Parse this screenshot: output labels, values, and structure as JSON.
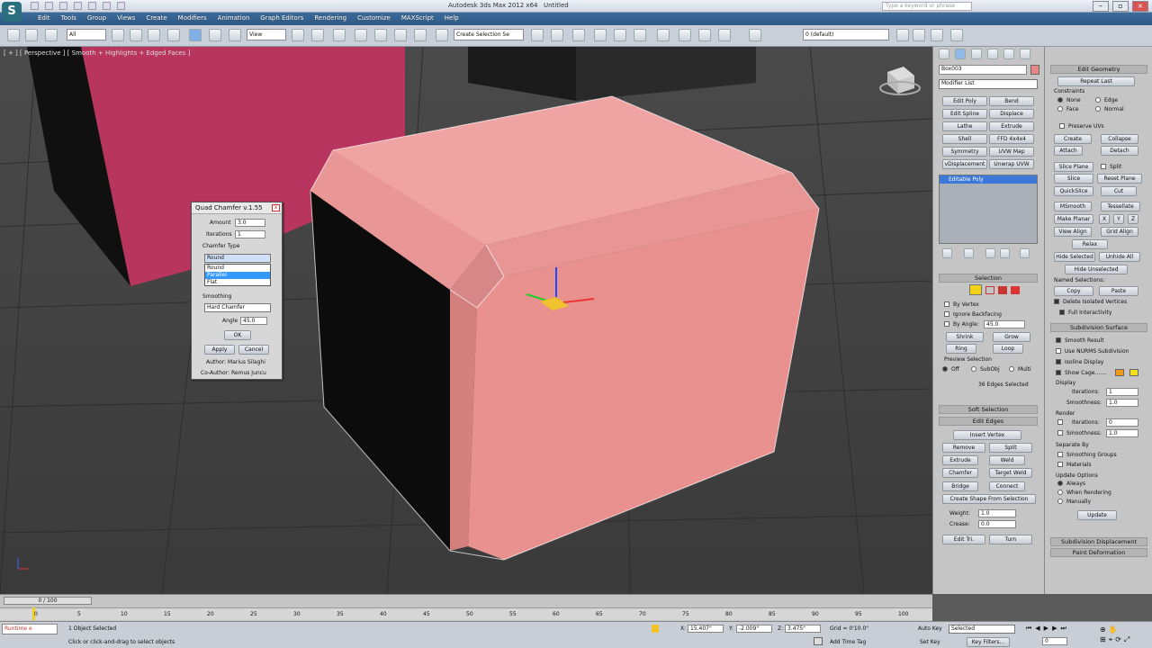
{
  "app": {
    "title": "Autodesk 3ds Max 2012 x64",
    "document": "Untitled",
    "search_placeholder": "Type a keyword or phrase"
  },
  "menu": [
    "Edit",
    "Tools",
    "Group",
    "Views",
    "Create",
    "Modifiers",
    "Animation",
    "Graph Editors",
    "Rendering",
    "Customize",
    "MAXScript",
    "Help"
  ],
  "toolbar": {
    "filter": "All",
    "ref_coord": "View",
    "selection_set": "Create Selection Se",
    "layer": "0 (default)"
  },
  "viewport": {
    "label": "[ + ] [ Perspective ] [ Smooth + Highlights + Edged Faces ]"
  },
  "dialog": {
    "title": "Quad Chamfer v.1.55",
    "amount_label": "Amount",
    "amount": "3.0",
    "iterations_label": "Iterations",
    "iterations": "1",
    "chamfer_type_label": "Chamfer Type",
    "chamfer_type": "Round",
    "options": [
      "Round",
      "Parallel",
      "Flat"
    ],
    "highlighted_option": "Parallel",
    "smoothing_label": "Smoothing",
    "smoothing": "Hard Chamfer",
    "angle_label": "Angle",
    "angle": "45.0",
    "ok": "OK",
    "apply": "Apply",
    "cancel": "Cancel",
    "author": "Author: Marius Silaghi",
    "coauthor": "Co-Author: Remus Juncu"
  },
  "cmd": {
    "object_name": "Box003",
    "object_color": "#e8888a",
    "modifier_list": "Modifier List",
    "mod_buttons": [
      "Edit Poly",
      "Bend",
      "Edit Spline",
      "Displace",
      "Lathe",
      "Extrude",
      "Shell",
      "FFD 4x4x4",
      "Symmetry",
      "UVW Map",
      "vDisplacement",
      "Unwrap UVW"
    ],
    "stack_item": "Editable Poly",
    "selection_hdr": "Selection",
    "by_vertex": "By Vertex",
    "ignore_backfacing": "Ignore Backfacing",
    "by_angle": "By Angle:",
    "by_angle_val": "45.0",
    "shrink": "Shrink",
    "grow": "Grow",
    "ring": "Ring",
    "loop": "Loop",
    "preview_selection": "Preview Selection",
    "off": "Off",
    "subobj": "SubObj",
    "multi": "Multi",
    "edges_selected": "36 Edges Selected",
    "soft_selection": "Soft Selection",
    "edit_edges": "Edit Edges",
    "insert_vertex": "Insert Vertex",
    "remove": "Remove",
    "split": "Split",
    "extrude": "Extrude",
    "weld": "Weld",
    "chamfer": "Chamfer",
    "target_weld": "Target Weld",
    "bridge": "Bridge",
    "connect": "Connect",
    "create_shape": "Create Shape From Selection",
    "weight_label": "Weight:",
    "weight": "1.0",
    "crease_label": "Crease:",
    "crease": "0.0",
    "edit_tri": "Edit Tri.",
    "turn": "Turn"
  },
  "right": {
    "edit_geometry": "Edit Geometry",
    "repeat_last": "Repeat Last",
    "constraints": "Constraints",
    "none": "None",
    "edge": "Edge",
    "face": "Face",
    "normal": "Normal",
    "preserve_uvs": "Preserve UVs",
    "create": "Create",
    "collapse": "Collapse",
    "attach": "Attach",
    "detach": "Detach",
    "slice_plane": "Slice Plane",
    "split": "Split",
    "slice": "Slice",
    "reset_plane": "Reset Plane",
    "quickslice": "QuickSlice",
    "cut": "Cut",
    "msmooth": "MSmooth",
    "tessellate": "Tessellate",
    "make_planar": "Make Planar",
    "x": "X",
    "y": "Y",
    "z": "Z",
    "view_align": "View Align",
    "grid_align": "Grid Align",
    "relax": "Relax",
    "hide_selected": "Hide Selected",
    "unhide_all": "Unhide All",
    "hide_unselected": "Hide Unselected",
    "named_selections": "Named Selections:",
    "copy": "Copy",
    "paste": "Paste",
    "delete_isolated": "Delete Isolated Vertices",
    "full_interactivity": "Full Interactivity",
    "subdivision_surface": "Subdivision Surface",
    "smooth_result": "Smooth Result",
    "use_nurms": "Use NURMS Subdivision",
    "isoline_display": "Isoline Display",
    "show_cage": "Show Cage.......",
    "display": "Display",
    "iterations_label": "Iterations:",
    "iterations": "1",
    "smoothness_label": "Smoothness:",
    "smoothness": "1.0",
    "render": "Render",
    "r_iterations": "0",
    "r_smoothness": "1.0",
    "separate_by": "Separate By",
    "smoothing_groups": "Smoothing Groups",
    "materials": "Materials",
    "update_options": "Update Options",
    "always": "Always",
    "when_rendering": "When Rendering",
    "manually": "Manually",
    "update": "Update",
    "subdivision_displacement": "Subdivision Displacement",
    "paint_deformation": "Paint Deformation"
  },
  "timeline": {
    "frame": "0 / 100",
    "ticks": [
      "0",
      "5",
      "10",
      "15",
      "20",
      "25",
      "30",
      "35",
      "40",
      "45",
      "50",
      "55",
      "60",
      "65",
      "70",
      "75",
      "80",
      "85",
      "90",
      "95",
      "100"
    ]
  },
  "status": {
    "runtime": "Runtime e",
    "objects_selected": "1 Object Selected",
    "prompt": "Click or click-and-drag to select objects",
    "x_label": "X:",
    "x": "15.407\"",
    "y_label": "Y:",
    "y": "-2.009\"",
    "z_label": "Z:",
    "z": "3.475\"",
    "grid": "Grid = 0'10.0\"",
    "add_time_tag": "Add Time Tag",
    "auto_key": "Auto Key",
    "set_key": "Set Key",
    "selected": "Selected",
    "key_filters": "Key Filters...",
    "frame_field": "0"
  }
}
